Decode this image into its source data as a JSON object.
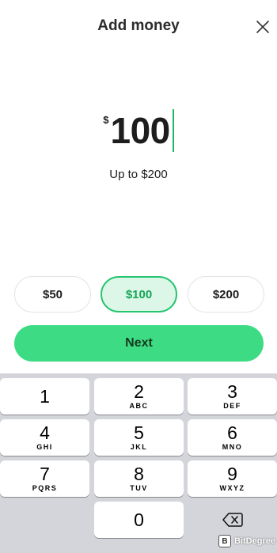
{
  "header": {
    "title": "Add money",
    "close_icon": "close-icon"
  },
  "amount": {
    "currency_symbol": "$",
    "value": "100",
    "limit_text": "Up to $200"
  },
  "presets": [
    {
      "label": "$50",
      "selected": false
    },
    {
      "label": "$100",
      "selected": true
    },
    {
      "label": "$200",
      "selected": false
    }
  ],
  "next_button": {
    "label": "Next"
  },
  "keypad": {
    "keys": [
      {
        "num": "1",
        "letters": ""
      },
      {
        "num": "2",
        "letters": "ABC"
      },
      {
        "num": "3",
        "letters": "DEF"
      },
      {
        "num": "4",
        "letters": "GHI"
      },
      {
        "num": "5",
        "letters": "JKL"
      },
      {
        "num": "6",
        "letters": "MNO"
      },
      {
        "num": "7",
        "letters": "PQRS"
      },
      {
        "num": "8",
        "letters": "TUV"
      },
      {
        "num": "9",
        "letters": "WXYZ"
      },
      {
        "num": "0",
        "letters": ""
      }
    ],
    "backspace_icon": "backspace-icon"
  },
  "watermark": {
    "text": "BitDegree"
  },
  "colors": {
    "accent": "#3ddc84",
    "selected_bg": "#dcf7e8",
    "selected_border": "#27c46f",
    "keyboard_bg": "#d3d5da"
  }
}
